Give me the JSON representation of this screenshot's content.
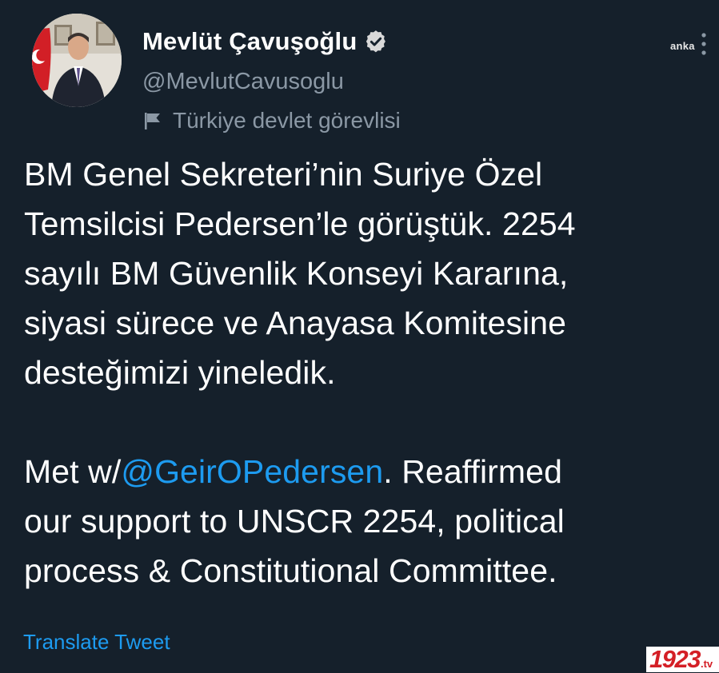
{
  "author": {
    "display_name": "Mevlüt Çavuşoğlu",
    "handle": "@MevlutCavusoglu",
    "account_label": "Türkiye devlet görevlisi",
    "verified": true
  },
  "tweet": {
    "turkish_lines": [
      "BM Genel Sekreteri’nin  Suriye Özel",
      "Temsilcisi Pedersen’le görüştük. 2254",
      "sayılı BM Güvenlik Konseyi Kararına,",
      "siyasi sürece ve Anayasa Komitesine",
      "desteğimizi yineledik."
    ],
    "english_prefix": "Met w/",
    "mention": "@GeirOPedersen",
    "english_line1_suffix": ". Reaffirmed",
    "english_line2": "our support to UNSCR 2254, political",
    "english_line3": "process & Constitutional Committee.",
    "translate_label": "Translate Tweet"
  },
  "watermarks": {
    "top_right": "anka",
    "bottom_right_number": "1923",
    "bottom_right_suffix": ".tv"
  },
  "colors": {
    "background": "#15202b",
    "link": "#1d9bf0",
    "secondary_text": "#8b98a5",
    "watermark_red": "#d41f26"
  },
  "icons": {
    "verified": "verified-badge-icon",
    "account_label": "flag-icon",
    "more": "more-vertical-icon"
  }
}
